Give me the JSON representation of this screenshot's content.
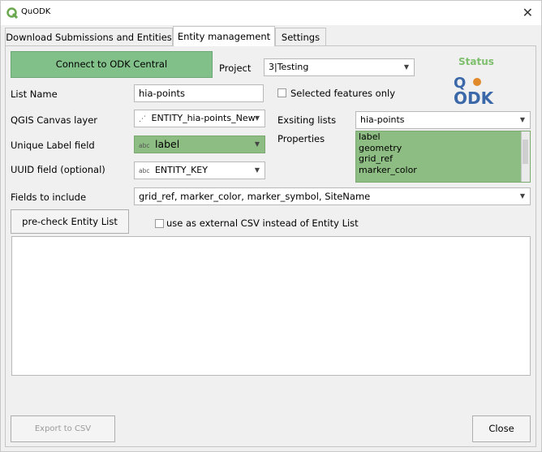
{
  "window": {
    "title": "QuODK",
    "close_glyph": "✕"
  },
  "tabs": [
    {
      "label": "Download Submissions and Entities"
    },
    {
      "label": "Entity management",
      "active": true
    },
    {
      "label": "Settings"
    }
  ],
  "connect_button": "Connect to ODK Central",
  "project": {
    "label": "Project",
    "value": "3|Testing"
  },
  "status": {
    "label": "Status",
    "logo_text": "QODK"
  },
  "list_name": {
    "label": "List Name",
    "value": "hia-points"
  },
  "selected_only": {
    "label": "Selected features only",
    "checked": false
  },
  "canvas_layer": {
    "label": "QGIS Canvas layer",
    "value": "ENTITY_hia-points_New"
  },
  "existing_lists": {
    "label": "Exsiting lists",
    "value": "hia-points"
  },
  "unique_label": {
    "label": "Unique Label field",
    "type_badge": "abc",
    "value": "label"
  },
  "properties": {
    "label": "Properties",
    "items": [
      "label",
      "geometry",
      "grid_ref",
      "marker_color"
    ]
  },
  "uuid_field": {
    "label": "UUID field (optional)",
    "type_badge": "abc",
    "value": "ENTITY_KEY"
  },
  "fields_include": {
    "label": "Fields to include",
    "value": "grid_ref, marker_color, marker_symbol, SiteName"
  },
  "precheck_button": "pre-check Entity List",
  "external_csv": {
    "label": "use as external CSV instead of Entity List",
    "checked": false
  },
  "export_button": "Export to CSV",
  "close_button": "Close",
  "colors": {
    "accent_green": "#8dbd82",
    "button_green": "#82c08a",
    "status_green": "#7dbf6c",
    "logo_blue": "#3a68a8",
    "logo_orange": "#e08a2c"
  }
}
